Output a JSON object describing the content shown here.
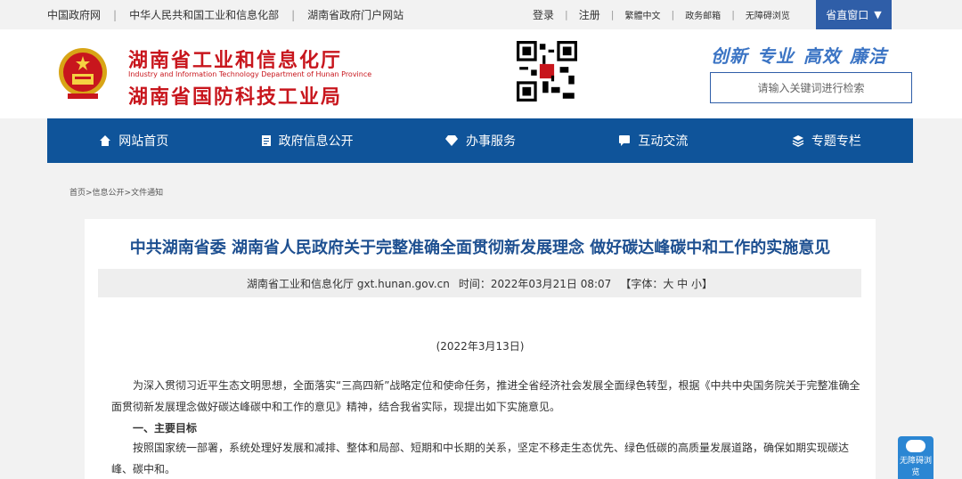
{
  "topbar": {
    "links": [
      "中国政府网",
      "中华人民共和国工业和信息化部",
      "湖南省政府门户网站"
    ],
    "login": "登录",
    "register": "注册",
    "traditional": "繁體中文",
    "weibo": "政务邮箱",
    "accessible": "无障碍浏览",
    "province_window": "省直窗口",
    "province_arrow": "▼"
  },
  "header": {
    "title_main": "湖南省工业和信息化厅",
    "title_en": "Industry and Information Technology Department of Hunan Province",
    "title_sub": "湖南省国防科技工业局",
    "slogans": [
      "创新",
      "专业",
      "高效",
      "廉洁"
    ],
    "search_placeholder": "请输入关键词进行检索"
  },
  "nav": {
    "items": [
      {
        "label": "网站首页",
        "icon": "home-icon"
      },
      {
        "label": "政府信息公开",
        "icon": "document-icon"
      },
      {
        "label": "办事服务",
        "icon": "diamond-icon"
      },
      {
        "label": "互动交流",
        "icon": "chat-icon"
      },
      {
        "label": "专题专栏",
        "icon": "layers-icon"
      }
    ]
  },
  "breadcrumb": "首页>信息公开>文件通知",
  "article": {
    "title": "中共湖南省委 湖南省人民政府关于完整准确全面贯彻新发展理念 做好碳达峰碳中和工作的实施意见",
    "source": "湖南省工业和信息化厅 gxt.hunan.gov.cn",
    "time": "时间：2022年03月21日 08:07",
    "font_size": "【字体：大 中 小】",
    "date": "(2022年3月13日)",
    "para1": "为深入贯彻习近平生态文明思想，全面落实“三高四新”战略定位和使命任务，推进全省经济社会发展全面绿色转型，根据《中共中央国务院关于完整准确全面贯彻新发展理念做好碳达峰碳中和工作的意见》精神，结合我省实际，现提出如下实施意见。",
    "heading1": "一、主要目标",
    "para2": "按照国家统一部署，系统处理好发展和减排、整体和局部、短期和中长期的关系，坚定不移走生态优先、绿色低碳的高质量发展道路，确保如期实现碳达峰、碳中和。"
  },
  "accessibility_widget": "无障碍浏览",
  "colors": {
    "nav": "#0f549a",
    "title_red": "#c8161d",
    "article_title": "#1d4f90"
  }
}
